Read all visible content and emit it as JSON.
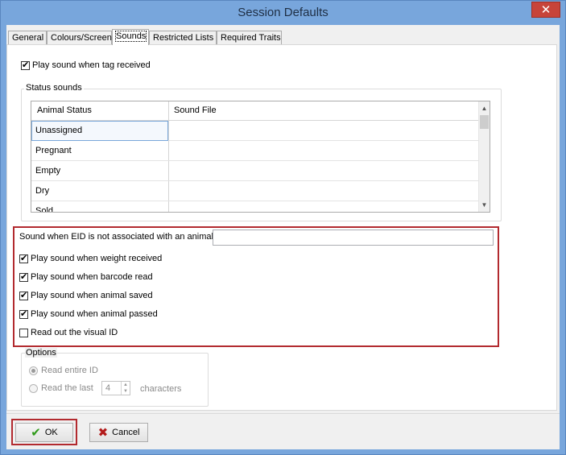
{
  "window": {
    "title": "Session Defaults",
    "close_glyph": "✕"
  },
  "tabs": [
    {
      "label": "General"
    },
    {
      "label": "Colours/Screen"
    },
    {
      "label": "Sounds"
    },
    {
      "label": "Restricted Lists"
    },
    {
      "label": "Required Traits"
    }
  ],
  "active_tab": "Sounds",
  "sounds": {
    "play_on_tag": {
      "label": "Play sound when tag received",
      "checked": true
    },
    "status_group": {
      "legend": "Status sounds",
      "columns": [
        "Animal Status",
        "Sound File"
      ],
      "rows": [
        {
          "status": "Unassigned",
          "file": ""
        },
        {
          "status": "Pregnant",
          "file": ""
        },
        {
          "status": "Empty",
          "file": ""
        },
        {
          "status": "Dry",
          "file": ""
        },
        {
          "status": "Sold",
          "file": ""
        }
      ]
    },
    "eid_not_associated": {
      "label": "Sound when EID is not associated with an animal",
      "value": ""
    },
    "weight": {
      "label": "Play sound when weight received",
      "checked": true
    },
    "barcode": {
      "label": "Play sound when barcode read",
      "checked": true
    },
    "saved": {
      "label": "Play sound when animal saved",
      "checked": true
    },
    "passed": {
      "label": "Play sound when animal passed",
      "checked": true
    },
    "visual_id": {
      "label": "Read out the visual ID",
      "checked": false
    }
  },
  "options": {
    "legend": "Options",
    "read_entire": {
      "label": "Read entire ID",
      "selected": true
    },
    "read_last": {
      "label": "Read the last",
      "selected": false
    },
    "count": "4",
    "suffix": "characters"
  },
  "buttons": {
    "ok": {
      "label": "OK",
      "icon": "checkmark-icon"
    },
    "cancel": {
      "label": "Cancel",
      "icon": "x-icon"
    }
  },
  "colors": {
    "highlight_border": "#b22a2f",
    "ok_icon": "#2f9a1a",
    "cancel_icon": "#b31b1b",
    "titlebar": "#78a6dc"
  }
}
